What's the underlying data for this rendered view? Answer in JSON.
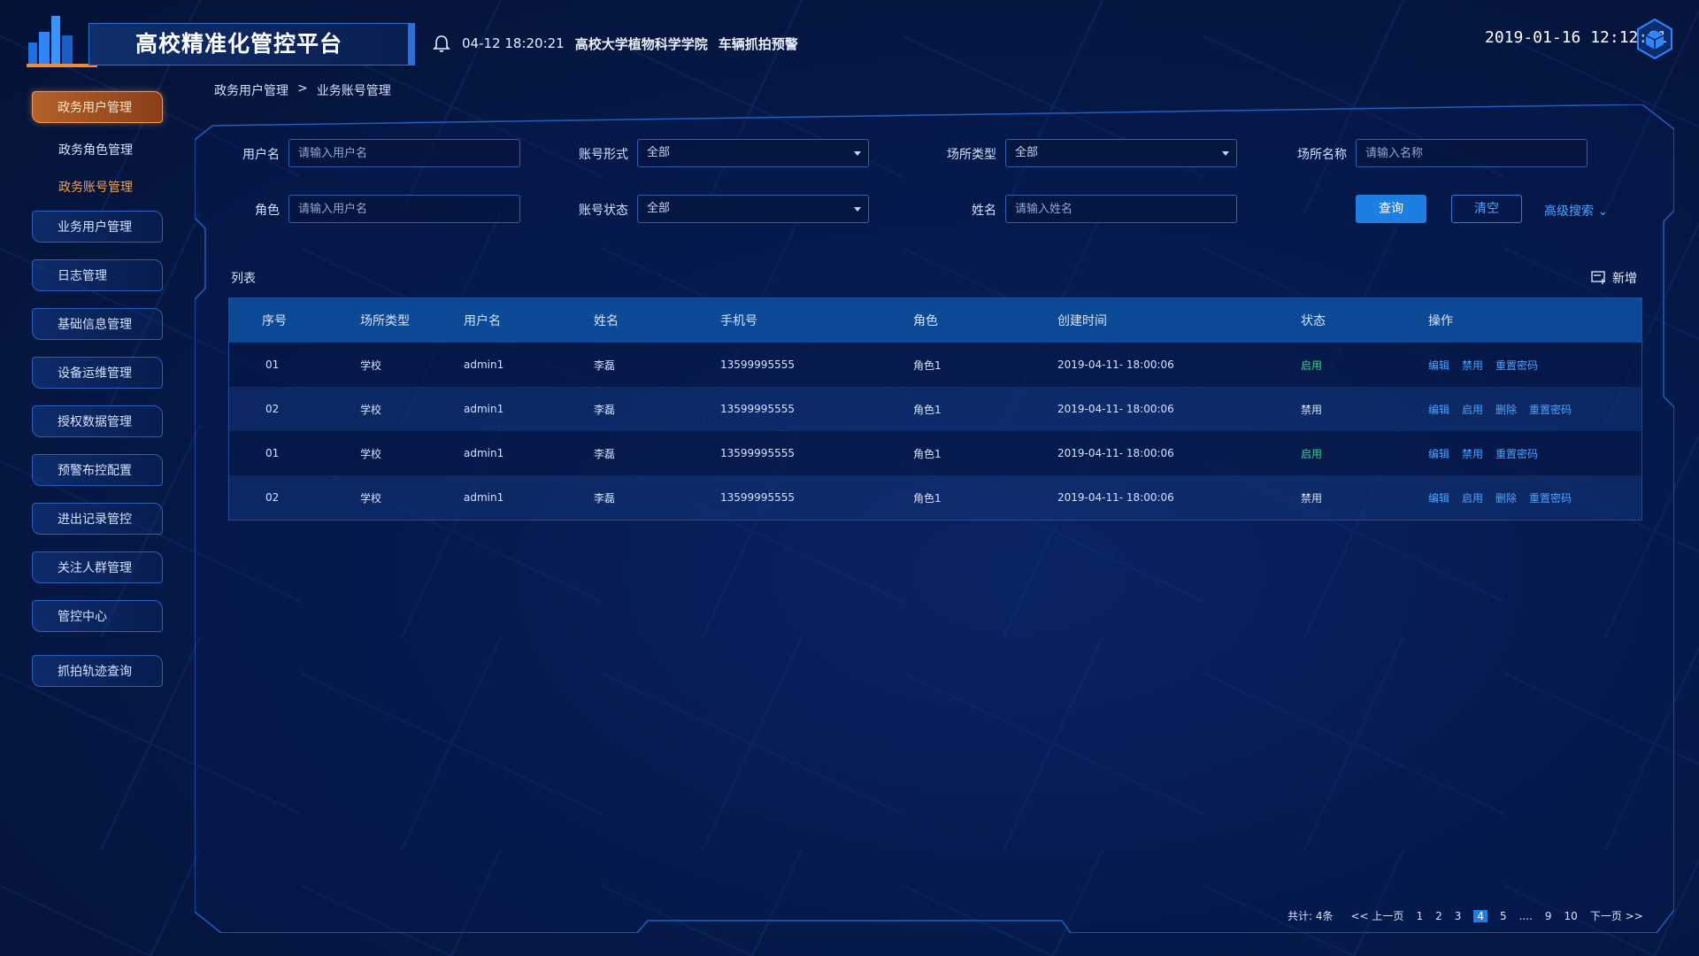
{
  "header": {
    "title": "高校精准化管控平台",
    "alert_time": "04-12 18:20:21",
    "alert_location": "高校大学植物科学学院",
    "alert_type": "车辆抓拍预警",
    "clock": "2019-01-16 12:12:01"
  },
  "sidebar": {
    "items": [
      {
        "label": "政务用户管理",
        "active": true
      },
      {
        "label": "政务角色管理",
        "sub": true
      },
      {
        "label": "政务账号管理",
        "sub": true,
        "active": true
      },
      {
        "label": "业务用户管理"
      },
      {
        "label": "日志管理"
      },
      {
        "label": "基础信息管理"
      },
      {
        "label": "设备运维管理"
      },
      {
        "label": "授权数据管理"
      },
      {
        "label": "预警布控配置"
      },
      {
        "label": "进出记录管控"
      },
      {
        "label": "关注人群管理"
      },
      {
        "label": "管控中心"
      },
      {
        "label": "抓拍轨迹查询"
      }
    ]
  },
  "breadcrumb": {
    "parent": "政务用户管理",
    "sep": ">",
    "current": "业务账号管理"
  },
  "filters": {
    "username_label": "用户名",
    "username_placeholder": "请输入用户名",
    "account_form_label": "账号形式",
    "account_form_value": "全部",
    "site_type_label": "场所类型",
    "site_type_value": "全部",
    "site_name_label": "场所名称",
    "site_name_placeholder": "请输入名称",
    "role_label": "角色",
    "role_placeholder": "请输入用户名",
    "account_status_label": "账号状态",
    "account_status_value": "全部",
    "name_label": "姓名",
    "name_placeholder": "请输入姓名",
    "query_label": "查询",
    "clear_label": "清空",
    "advanced_label": "高级搜索"
  },
  "list": {
    "title": "列表",
    "add_label": "新增"
  },
  "table": {
    "columns": [
      "序号",
      "场所类型",
      "用户名",
      "姓名",
      "手机号",
      "角色",
      "创建时间",
      "状态",
      "操作"
    ],
    "rows": [
      {
        "no": "01",
        "site_type": "学校",
        "username": "admin1",
        "name": "李磊",
        "phone": "13599995555",
        "role": "角色1",
        "created": "2019-04-11- 18:00:06",
        "status": "启用",
        "enabled": true,
        "ops": [
          "编辑",
          "禁用",
          "重置密码"
        ]
      },
      {
        "no": "02",
        "site_type": "学校",
        "username": "admin1",
        "name": "李磊",
        "phone": "13599995555",
        "role": "角色1",
        "created": "2019-04-11- 18:00:06",
        "status": "禁用",
        "enabled": false,
        "ops": [
          "编辑",
          "启用",
          "删除",
          "重置密码"
        ]
      },
      {
        "no": "01",
        "site_type": "学校",
        "username": "admin1",
        "name": "李磊",
        "phone": "13599995555",
        "role": "角色1",
        "created": "2019-04-11- 18:00:06",
        "status": "启用",
        "enabled": true,
        "ops": [
          "编辑",
          "禁用",
          "重置密码"
        ]
      },
      {
        "no": "02",
        "site_type": "学校",
        "username": "admin1",
        "name": "李磊",
        "phone": "13599995555",
        "role": "角色1",
        "created": "2019-04-11- 18:00:06",
        "status": "禁用",
        "enabled": false,
        "ops": [
          "编辑",
          "启用",
          "删除",
          "重置密码"
        ]
      }
    ]
  },
  "pagination": {
    "total": "共计: 4条",
    "prev": "<< 上一页",
    "pages": [
      "1",
      "2",
      "3",
      "4",
      "5",
      "....",
      "9",
      "10"
    ],
    "current": "4",
    "next": "下一页 >>"
  },
  "colors": {
    "accent": "#1d7fe2",
    "active_nav": "#b4622a",
    "enabled": "#36d48d"
  }
}
